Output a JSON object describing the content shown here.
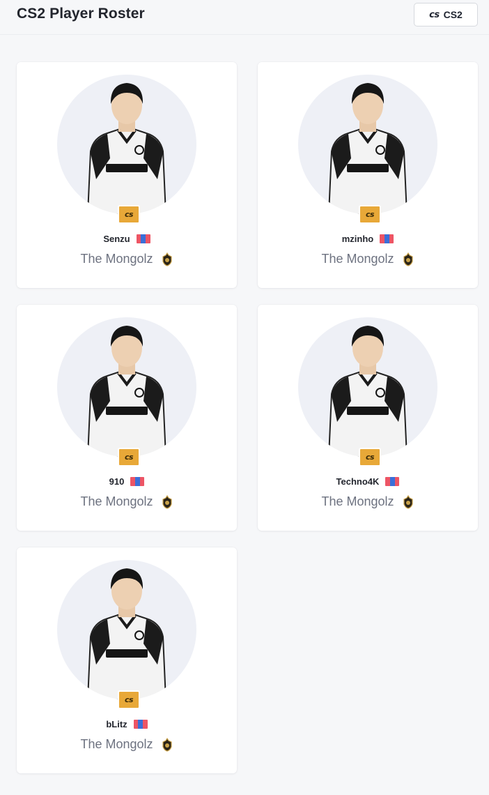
{
  "header": {
    "title": "CS2 Player Roster",
    "game_button": {
      "logo_text": "cs",
      "label": "CS2"
    }
  },
  "badge_logo_text": "cs",
  "colors": {
    "badge": "#e8a838",
    "flag_red": "#ed5565",
    "flag_blue": "#3b6fd8",
    "avatar_bg": "#eef0f6"
  },
  "players": [
    {
      "name": "Senzu",
      "team": "The Mongolz",
      "flag": "mongolia-flag"
    },
    {
      "name": "mzinho",
      "team": "The Mongolz",
      "flag": "mongolia-flag"
    },
    {
      "name": "910",
      "team": "The Mongolz",
      "flag": "mongolia-flag"
    },
    {
      "name": "Techno4K",
      "team": "The Mongolz",
      "flag": "mongolia-flag"
    },
    {
      "name": "bLitz",
      "team": "The Mongolz",
      "flag": "mongolia-flag"
    }
  ]
}
